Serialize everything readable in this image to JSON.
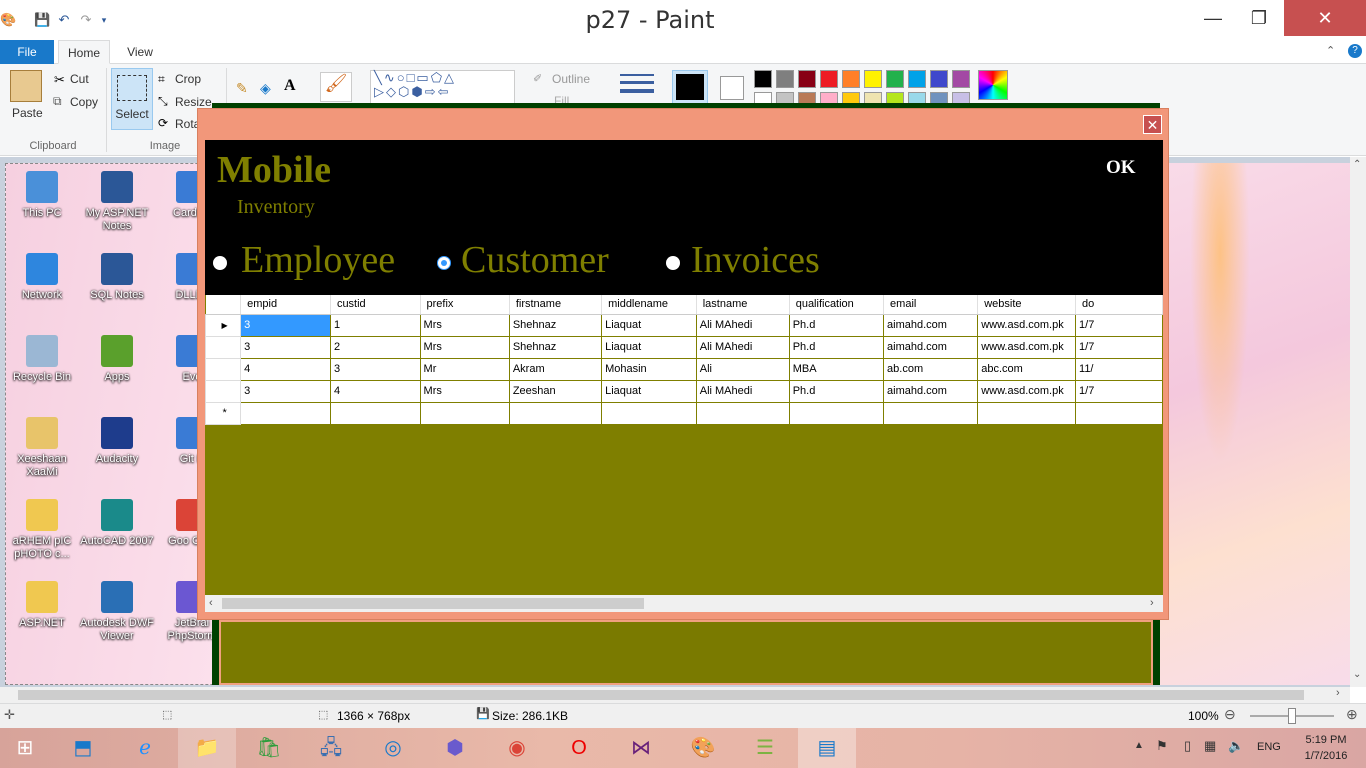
{
  "window": {
    "title": "p27 - Paint",
    "minimize": "—",
    "maximize": "❐",
    "close": "✕"
  },
  "ribbon_tabs": [
    "File",
    "Home",
    "View"
  ],
  "ribbon": {
    "clipboard": {
      "paste": "Paste",
      "cut": "Cut",
      "copy": "Copy",
      "group": "Clipboard"
    },
    "image": {
      "select": "Select",
      "crop": "Crop",
      "resize": "Resize",
      "rotate": "Rota",
      "group": "Image"
    },
    "shapes": {
      "outline": "Outline",
      "fill": "Fill"
    }
  },
  "palette_row1": [
    "#000000",
    "#7f7f7f",
    "#880015",
    "#ed1c24",
    "#ff7f27",
    "#fff200",
    "#22b14c",
    "#00a2e8",
    "#3f48cc",
    "#a349a4"
  ],
  "palette_row2": [
    "#ffffff",
    "#c3c3c3",
    "#b97a57",
    "#ffaec9",
    "#ffc90e",
    "#efe4b0",
    "#b5e61d",
    "#99d9ea",
    "#7092be",
    "#c8bfe7"
  ],
  "desktop_icons": [
    {
      "label": "This PC",
      "icon": "computer-icon"
    },
    {
      "label": "My ASP.NET Notes",
      "icon": "word-doc-icon"
    },
    {
      "label": "CardRe",
      "icon": "shortcut-icon"
    },
    {
      "label": "Network",
      "icon": "network-icon"
    },
    {
      "label": "SQL Notes",
      "icon": "word-doc-icon"
    },
    {
      "label": "DLLEs",
      "icon": "shortcut-icon"
    },
    {
      "label": "Recycle Bin",
      "icon": "recycle-bin-icon"
    },
    {
      "label": "Apps",
      "icon": "apps-icon"
    },
    {
      "label": "Evo",
      "icon": "shortcut-icon"
    },
    {
      "label": "Xeeshaan XaaMi",
      "icon": "user-folder-icon"
    },
    {
      "label": "Audacity",
      "icon": "audacity-icon"
    },
    {
      "label": "Git B",
      "icon": "shortcut-icon"
    },
    {
      "label": "aRHEM pIC pHOTO c...",
      "icon": "folder-icon"
    },
    {
      "label": "AutoCAD 2007",
      "icon": "autocad-icon"
    },
    {
      "label": "Goo Chro",
      "icon": "chrome-icon"
    },
    {
      "label": "ASP.NET",
      "icon": "folder-icon"
    },
    {
      "label": "Autodesk DWF Viewer",
      "icon": "dwf-icon"
    },
    {
      "label": "JetBrai PhpStorm",
      "icon": "phpstorm-icon"
    }
  ],
  "dialog": {
    "close": "✕",
    "brand": "Mobile",
    "subtitle": "Inventory",
    "ok": "OK",
    "radios": [
      {
        "label": "Employee",
        "selected": false
      },
      {
        "label": "Customer",
        "selected": true
      },
      {
        "label": "Invoices",
        "selected": false
      }
    ]
  },
  "grid": {
    "columns": [
      "empid",
      "custid",
      "prefix",
      "firstname",
      "middlename",
      "lastname",
      "qualification",
      "email",
      "website",
      "do"
    ],
    "rows": [
      [
        "3",
        "1",
        "Mrs",
        "Shehnaz",
        "Liaquat",
        "Ali MAhedi",
        "Ph.d",
        "aimahd.com",
        "www.asd.com.pk",
        "1/7"
      ],
      [
        "3",
        "2",
        "Mrs",
        "Shehnaz",
        "Liaquat",
        "Ali MAhedi",
        "Ph.d",
        "aimahd.com",
        "www.asd.com.pk",
        "1/7"
      ],
      [
        "4",
        "3",
        "Mr",
        "Akram",
        "Mohasin",
        "Ali",
        "MBA",
        "ab.com",
        "abc.com",
        "11/"
      ],
      [
        "3",
        "4",
        "Mrs",
        "Zeeshan",
        "Liaquat",
        "Ali MAhedi",
        "Ph.d",
        "aimahd.com",
        "www.asd.com.pk",
        "1/7"
      ]
    ],
    "current_row_marker": "▶",
    "new_row_marker": "*"
  },
  "statusbar": {
    "dimensions": "1366 × 768px",
    "size": "Size: 286.1KB",
    "zoom": "100%"
  },
  "tray": {
    "lang": "ENG",
    "time": "5:19 PM",
    "date": "1/7/2016"
  }
}
